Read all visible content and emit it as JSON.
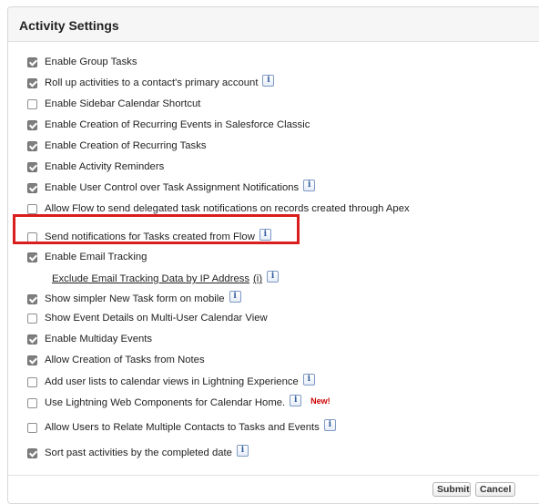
{
  "panel": {
    "title": "Activity Settings"
  },
  "settings": [
    {
      "label": "Enable Group Tasks",
      "checked": true,
      "info": false
    },
    {
      "label": "Roll up activities to a contact's primary account",
      "checked": true,
      "info": true
    },
    {
      "label": "Enable Sidebar Calendar Shortcut",
      "checked": false,
      "info": false
    },
    {
      "label": "Enable Creation of Recurring Events in Salesforce Classic",
      "checked": true,
      "info": false
    },
    {
      "label": "Enable Creation of Recurring Tasks",
      "checked": true,
      "info": false
    },
    {
      "label": "Enable Activity Reminders",
      "checked": true,
      "info": false
    },
    {
      "label": "Enable User Control over Task Assignment Notifications",
      "checked": true,
      "info": true
    },
    {
      "label": "Allow Flow to send delegated task notifications on records created through Apex",
      "checked": false,
      "info": false
    },
    {
      "label": "Send notifications for Tasks created from Flow",
      "checked": false,
      "info": true
    },
    {
      "label": "Enable Email Tracking",
      "checked": true,
      "info": false
    },
    {
      "label": "Show simpler New Task form on mobile",
      "checked": true,
      "info": true
    },
    {
      "label": "Show Event Details on Multi-User Calendar View",
      "checked": false,
      "info": false
    },
    {
      "label": "Enable Multiday Events",
      "checked": true,
      "info": false
    },
    {
      "label": "Allow Creation of Tasks from Notes",
      "checked": true,
      "info": false
    },
    {
      "label": "Add user lists to calendar views in Lightning Experience",
      "checked": false,
      "info": true
    },
    {
      "label": "Use Lightning Web Components for Calendar Home.",
      "checked": false,
      "info": true,
      "badge": "New!"
    },
    {
      "label": "Allow Users to Relate Multiple Contacts to Tasks and Events",
      "checked": false,
      "info": true
    },
    {
      "label": "Sort past activities by the completed date",
      "checked": true,
      "info": true
    }
  ],
  "email_tracking_link": {
    "label": "Exclude Email Tracking Data by IP Address",
    "suffix": "(i)"
  },
  "info_glyph": "i",
  "buttons": {
    "submit": "Submit",
    "cancel": "Cancel"
  },
  "colors": {
    "highlight": "#d91e1e",
    "new_badge": "#cc0000",
    "checkbox_checked": "#7f7f7f"
  }
}
